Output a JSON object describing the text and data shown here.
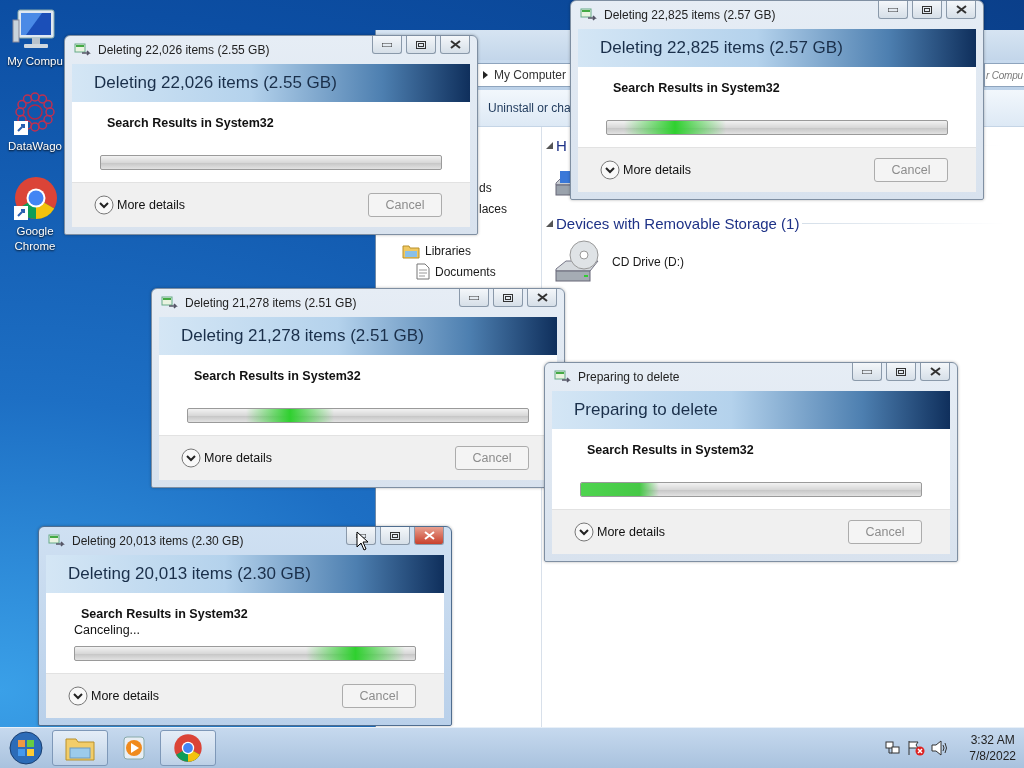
{
  "desktop_icons": [
    {
      "label": "My Compu",
      "kind": "computer"
    },
    {
      "label": "DataWago",
      "kind": "datawagon"
    },
    {
      "label": "Google Chrome",
      "kind": "chrome"
    }
  ],
  "explorer": {
    "breadcrumb": "My Computer",
    "search_placeholder": "r Compu",
    "toolbar_item": "Uninstall or cha",
    "nav_items": [
      {
        "label": "ds",
        "kind": "fragment"
      },
      {
        "label": "laces",
        "kind": "fragment"
      },
      {
        "label": "Libraries",
        "kind": "library"
      },
      {
        "label": "Documents",
        "kind": "document"
      }
    ],
    "groups": [
      {
        "heading": "H",
        "items": [
          {
            "kind": "hard-disk"
          }
        ]
      },
      {
        "heading": "Devices with Removable Storage (1)",
        "items": [
          {
            "kind": "cd-drive",
            "label": "CD Drive (D:)"
          }
        ]
      }
    ]
  },
  "windows": [
    {
      "title": "Deleting 22,026 items (2.55 GB)",
      "heading": "Deleting 22,026 items (2.55 GB)",
      "source": "Search Results in System32",
      "marquee": false,
      "details": "More details",
      "cancel": {
        "label": "Cancel",
        "disabled": true
      },
      "active": false
    },
    {
      "title": "Deleting 22,825 items (2.57 GB)",
      "heading": "Deleting 22,825 items (2.57 GB)",
      "source": "Search Results in System32",
      "marquee": true,
      "details": "More details",
      "cancel": {
        "label": "Cancel",
        "disabled": true
      },
      "active": false
    },
    {
      "title": "Deleting 21,278 items (2.51 GB)",
      "heading": "Deleting 21,278 items (2.51 GB)",
      "source": "Search Results in System32",
      "marquee": true,
      "details": "More details",
      "cancel": {
        "label": "Cancel",
        "disabled": true
      },
      "active": false
    },
    {
      "title": "Preparing to delete",
      "heading": "Preparing to delete",
      "source": "Search Results in System32",
      "marquee": true,
      "details": "More details",
      "cancel": {
        "label": "Cancel",
        "disabled": true
      },
      "active": false
    },
    {
      "title": "Deleting 20,013 items (2.30 GB)",
      "heading": "Deleting 20,013 items (2.30 GB)",
      "source": "Search Results in System32",
      "status": "Canceling...",
      "marquee": true,
      "details": "More details",
      "cancel": {
        "label": "Cancel",
        "disabled": true
      },
      "active": true
    }
  ],
  "taskbar": {
    "items": [
      {
        "kind": "explorer",
        "running": true
      },
      {
        "kind": "media-player",
        "running": false
      },
      {
        "kind": "chrome",
        "running": true
      }
    ],
    "time": "3:32 AM",
    "date": "7/8/2022"
  }
}
